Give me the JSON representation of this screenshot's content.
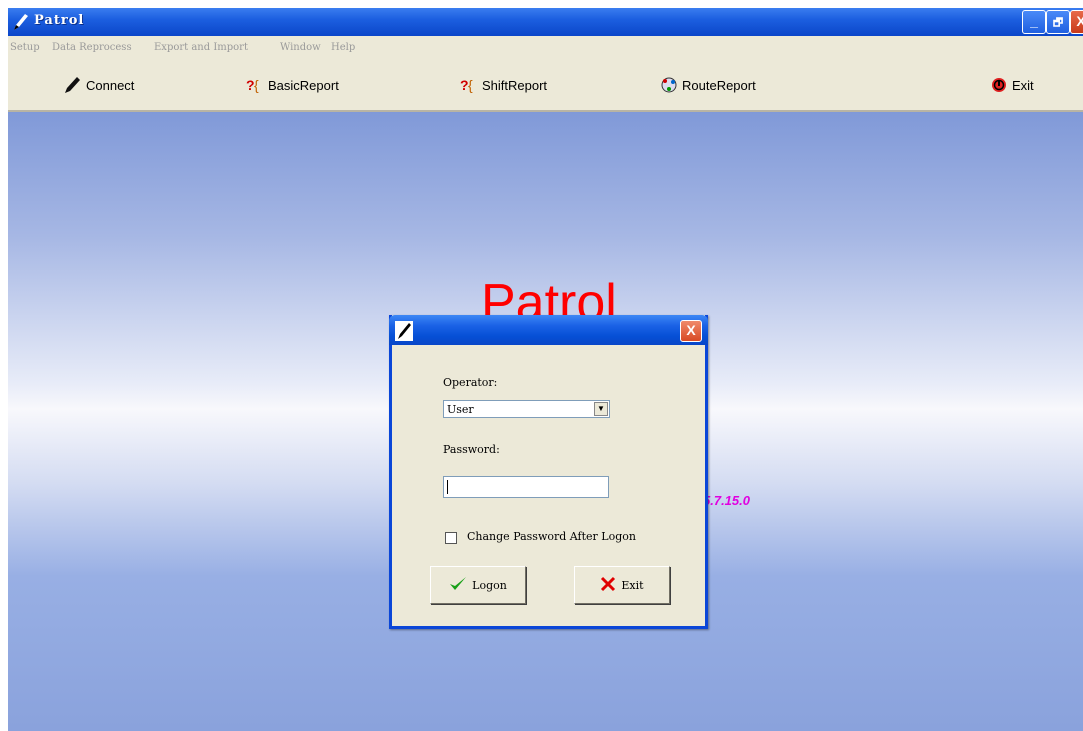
{
  "window": {
    "title": "Patrol",
    "controls": {
      "minimize": "_",
      "restore": "🗗",
      "close": "X"
    }
  },
  "menu": {
    "items": [
      "Setup",
      "Data Reprocess",
      "Export and Import",
      "Window",
      "Help"
    ]
  },
  "toolbar": {
    "buttons": [
      {
        "label": "Connect",
        "icon": "pen-icon"
      },
      {
        "label": "BasicReport",
        "icon": "report-icon"
      },
      {
        "label": "ShiftReport",
        "icon": "report-icon"
      },
      {
        "label": "RouteReport",
        "icon": "route-icon"
      },
      {
        "label": "Exit",
        "icon": "exit-icon"
      }
    ]
  },
  "main": {
    "app_name": "Patrol",
    "version": "5.7.15.0"
  },
  "dialog": {
    "operator_label": "Operator:",
    "operator_value": "User",
    "password_label": "Password:",
    "password_value": "",
    "change_password_label": "Change Password After Logon",
    "change_password_checked": false,
    "logon_label": "Logon",
    "exit_label": "Exit"
  },
  "colors": {
    "titlebar": "#0b46c9",
    "title_text": "#ff0000",
    "version_text": "#e000e0",
    "chrome": "#ece9d8"
  }
}
